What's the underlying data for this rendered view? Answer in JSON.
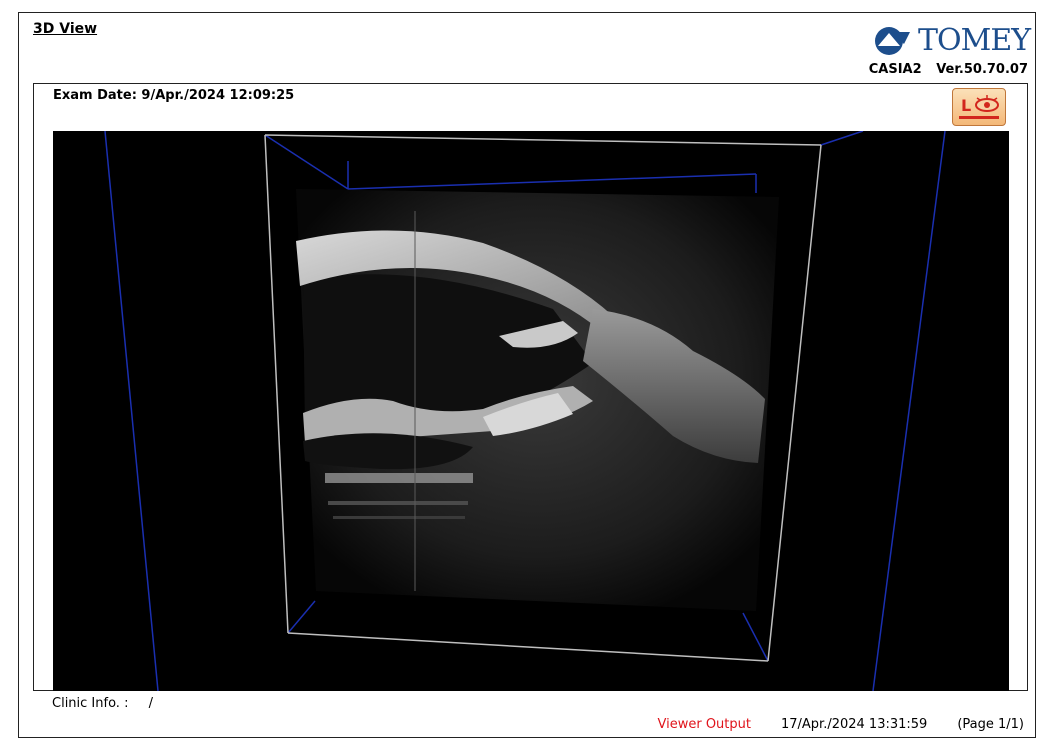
{
  "report": {
    "title": "3D View",
    "brand": "TOMEY",
    "model": "CASIA2",
    "version": "Ver.50.70.07",
    "exam_date": "Exam Date: 9/Apr./2024 12:09:25",
    "eye_indicator": "L",
    "clinic_label": "Clinic Info. :",
    "clinic_value": "/",
    "viewer_output": "Viewer Output",
    "output_datetime": "17/Apr./2024 13:31:59",
    "page": "(Page 1/1)"
  },
  "colors": {
    "brand_blue": "#1d4e8c",
    "viewer_output_red": "#e0141b",
    "badge_orange": "#f4b878",
    "eye_red": "#d2261d"
  }
}
